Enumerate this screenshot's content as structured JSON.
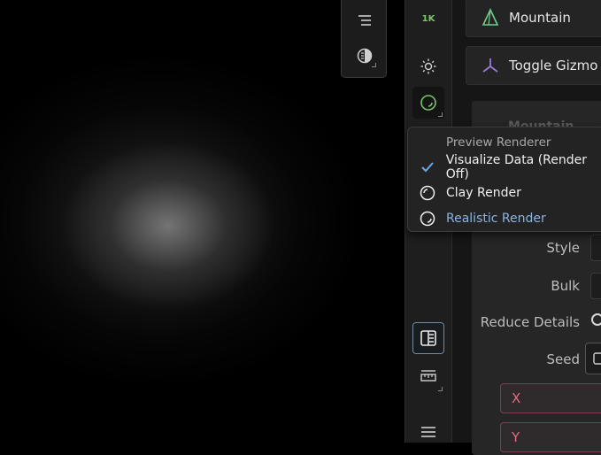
{
  "viewport": {
    "toolbar": {
      "icons": [
        "list-icon",
        "half-circle-display-icon"
      ]
    }
  },
  "strip": {
    "resolution_label": "1K",
    "icons": [
      "sun-icon",
      "realistic-sphere-icon",
      "split-view-icon",
      "ruler-icon",
      "menu-icon"
    ]
  },
  "panel": {
    "mountain_label": "Mountain",
    "gizmo_label": "Toggle Gizmo",
    "section_title": "Mountain",
    "props": {
      "style": "Style",
      "bulk": "Bulk",
      "reduce_details": "Reduce Details",
      "seed": "Seed"
    },
    "fields": {
      "x": "X",
      "y": "Y"
    }
  },
  "dropdown": {
    "title": "Preview Renderer",
    "items": [
      {
        "label": "Visualize Data (Render Off)",
        "icon": "checkmark-icon",
        "selected": true
      },
      {
        "label": "Clay Render",
        "icon": "clay-sphere-icon",
        "selected": false
      },
      {
        "label": "Realistic Render",
        "icon": "realistic-sphere-icon",
        "selected": false
      }
    ]
  },
  "colors": {
    "accent_blue": "#8ab4e0",
    "accent_green": "#7cc46a",
    "field_red": "#e06a86",
    "gizmo_purple": "#9a7ad6"
  }
}
